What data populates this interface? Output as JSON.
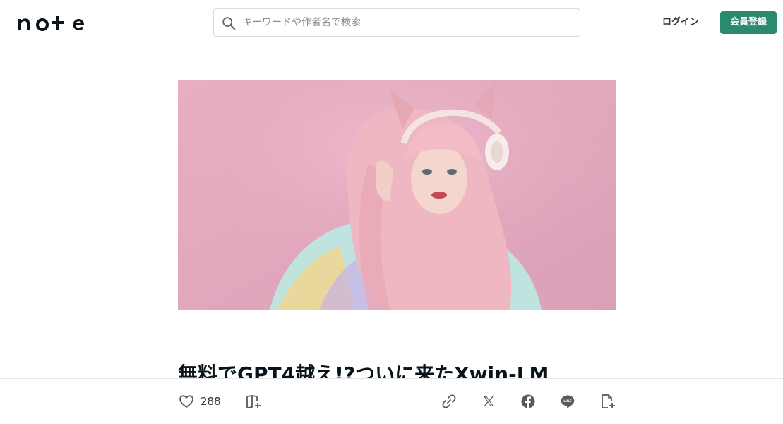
{
  "header": {
    "logo_text": "note",
    "search": {
      "placeholder": "キーワードや作者名で検索",
      "value": "",
      "icon": "search-icon"
    },
    "login_label": "ログイン",
    "signup_label": "会員登録"
  },
  "hero": {
    "icon": "cover-image"
  },
  "article": {
    "title": "無料でGPT4越え!?ついに来たXwin-LM"
  },
  "actions": {
    "like_count": "288",
    "icons": [
      "heart-icon",
      "magazine-add-icon",
      "link-icon",
      "x-icon",
      "facebook-icon",
      "line-icon",
      "note-add-icon"
    ]
  },
  "colors": {
    "accent": "#2a8a6d",
    "text": "#08131a",
    "icon": "#5a5a5a"
  }
}
